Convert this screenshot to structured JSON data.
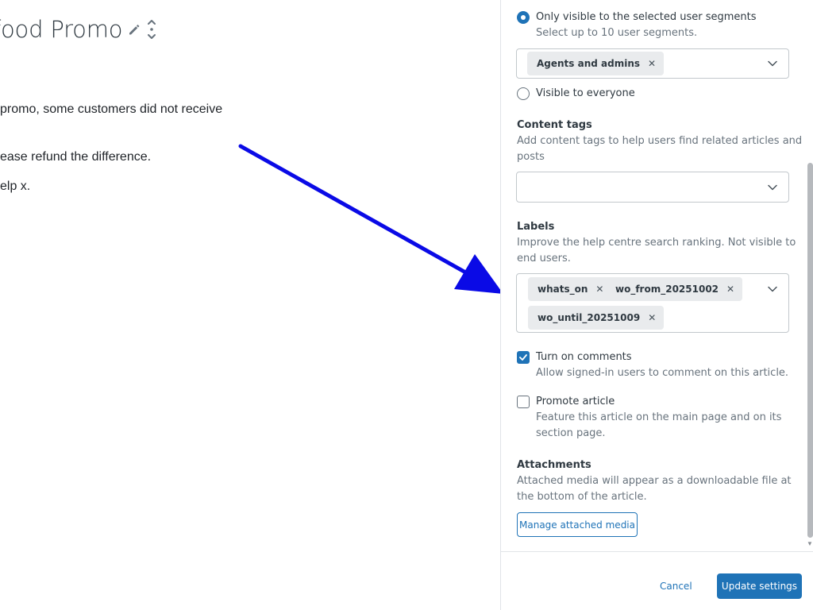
{
  "editor": {
    "title": "food Promo",
    "body_lines": [
      "promo, some customers did not receive",
      "ease refund the difference.",
      "elp x."
    ]
  },
  "settings": {
    "visibility": {
      "option_segments": {
        "label": "Only visible to the selected user segments",
        "hint": "Select up to 10 user segments.",
        "selected": true
      },
      "segments": [
        "Agents and admins"
      ],
      "option_everyone": {
        "label": "Visible to everyone",
        "selected": false
      }
    },
    "content_tags": {
      "label": "Content tags",
      "hint_line1": "Add content tags to help users find related articles and",
      "hint_line2": "posts",
      "value": ""
    },
    "labels": {
      "label": "Labels",
      "hint_line1": "Improve the help centre search ranking. Not visible to",
      "hint_line2": "end users.",
      "items": [
        "whats_on",
        "wo_from_20251002",
        "wo_until_20251009"
      ]
    },
    "comments": {
      "label": "Turn on comments",
      "hint": "Allow signed-in users to comment on this article.",
      "checked": true
    },
    "promote": {
      "label": "Promote article",
      "hint_line1": "Feature this article on the main page and on its",
      "hint_line2": "section page.",
      "checked": false
    },
    "attachments": {
      "label": "Attachments",
      "hint_line1": "Attached media will appear as a downloadable file at",
      "hint_line2": "the bottom of the article.",
      "button": "Manage attached media"
    }
  },
  "footer": {
    "cancel": "Cancel",
    "update": "Update settings"
  },
  "colors": {
    "accent": "#1f73b7",
    "annotation_arrow": "#0a0ae6"
  },
  "icons": [
    "pencil-icon",
    "drag-handle-icon",
    "chevron-down-icon",
    "remove-tag-icon",
    "checkmark-icon"
  ]
}
